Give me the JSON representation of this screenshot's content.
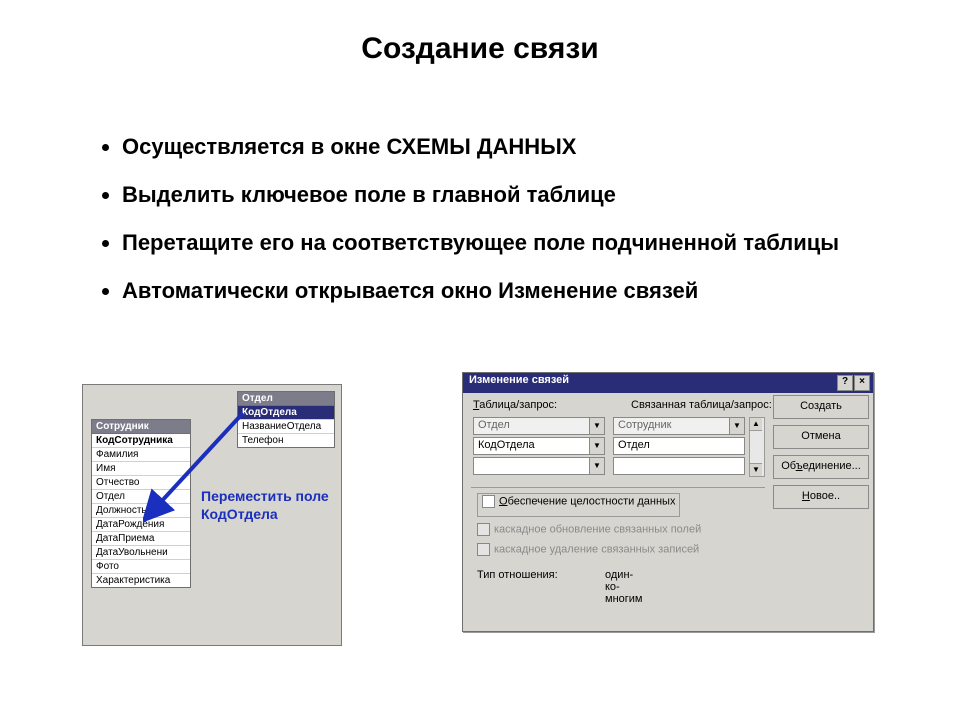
{
  "title": "Создание связи",
  "bullets": [
    "Осуществляется в окне СХЕМЫ ДАННЫХ",
    "Выделить ключевое поле в главной таблице",
    "Перетащите его на соответствующее поле подчиненной таблицы",
    "Автоматически открывается окно Изменение связей"
  ],
  "empTable": {
    "header": "Сотрудник",
    "fields": [
      "КодСотрудника",
      "Фамилия",
      "Имя",
      "Отчество",
      "Отдел",
      "Должность",
      "ДатаРождения",
      "ДатаПриема",
      "ДатаУвольнени",
      "Фото",
      "Характеристика"
    ]
  },
  "depTable": {
    "header": "Отдел",
    "fields": [
      "КодОтдела",
      "НазваниеОтдела",
      "Телефон"
    ]
  },
  "caption": "Переместить поле КодОтдела",
  "dialog": {
    "title": "Изменение связей",
    "help": "?",
    "close": "×",
    "labelTable": "Таблица/запрос:",
    "labelLinked": "Связанная таблица/запрос:",
    "t1": "Отдел",
    "t2": "Сотрудник",
    "f1": "КодОтдела",
    "f2": "Отдел",
    "btnCreate": "Создать",
    "btnCancel": "Отмена",
    "btnJoin": "Объединение...",
    "btnNew": "Новое..",
    "chkIntegrity": "Обеспечение целостности данных",
    "chkCascadeUpd": "каскадное обновление связанных полей",
    "chkCascadeDel": "каскадное удаление связанных записей",
    "relLabel": "Тип отношения:",
    "relValue": "один-ко-многим"
  }
}
